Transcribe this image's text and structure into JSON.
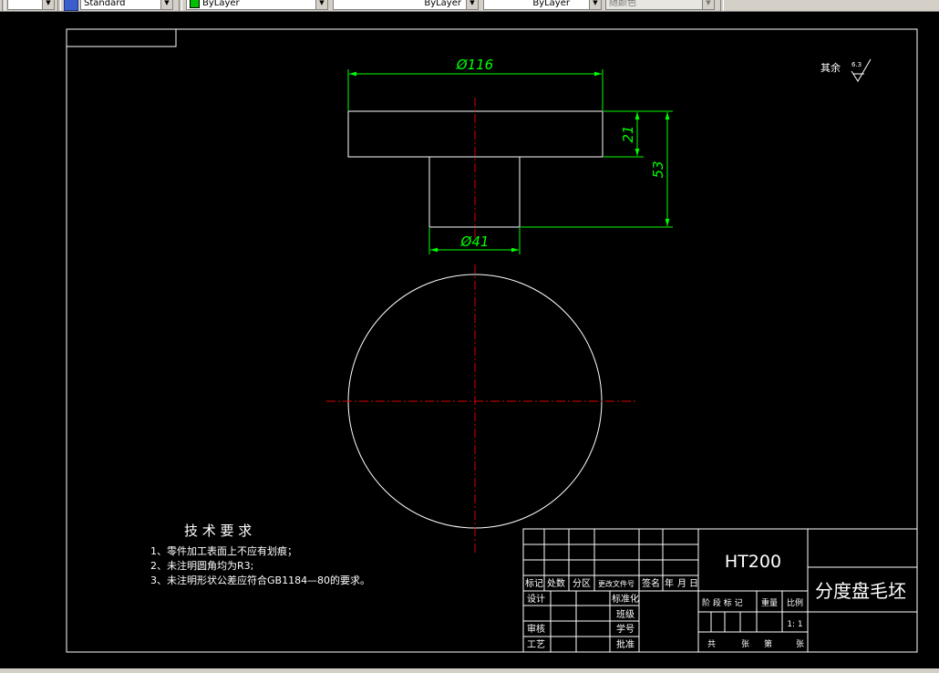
{
  "toolbar": {
    "text_style": "Standard",
    "layer": "ByLayer",
    "linetype": "ByLayer",
    "lineweight": "ByLayer",
    "plot_style": "随颜色"
  },
  "colors": {
    "background": "#000000",
    "object_lines": "#ffffff",
    "dimensions": "#00ff00",
    "centerlines": "#ff0000"
  },
  "drawing": {
    "dim_top_diameter": "Ø116",
    "dim_flange_thickness": "21",
    "dim_total_height": "53",
    "dim_hub_diameter": "Ø41",
    "surface_finish_note": "其余",
    "surface_finish_value": "6.3"
  },
  "tech_requirements": {
    "title": "技 术 要 求",
    "items": [
      "1、零件加工表面上不应有划痕；",
      "2、未注明圆角均为R3;",
      "3、未注明形状公差应符合GB1184—80的要求。"
    ]
  },
  "title_block": {
    "rev_headers": [
      "标记",
      "处数",
      "分区",
      "更改文件号",
      "签名",
      "年",
      "月",
      "日"
    ],
    "design": "设计",
    "standardization": "标准化",
    "class": "班级",
    "student_id": "学号",
    "approve": "批准",
    "review": "审核",
    "process": "工艺",
    "material": "HT200",
    "part_name": "分度盘毛坯",
    "stage_mark": "阶 段 标 记",
    "weight": "重量",
    "scale_label": "比例",
    "scale_value": "1: 1",
    "sheets_total": "共",
    "sheets_unit": "张",
    "sheet_no": "第",
    "sheet_unit2": "张"
  }
}
